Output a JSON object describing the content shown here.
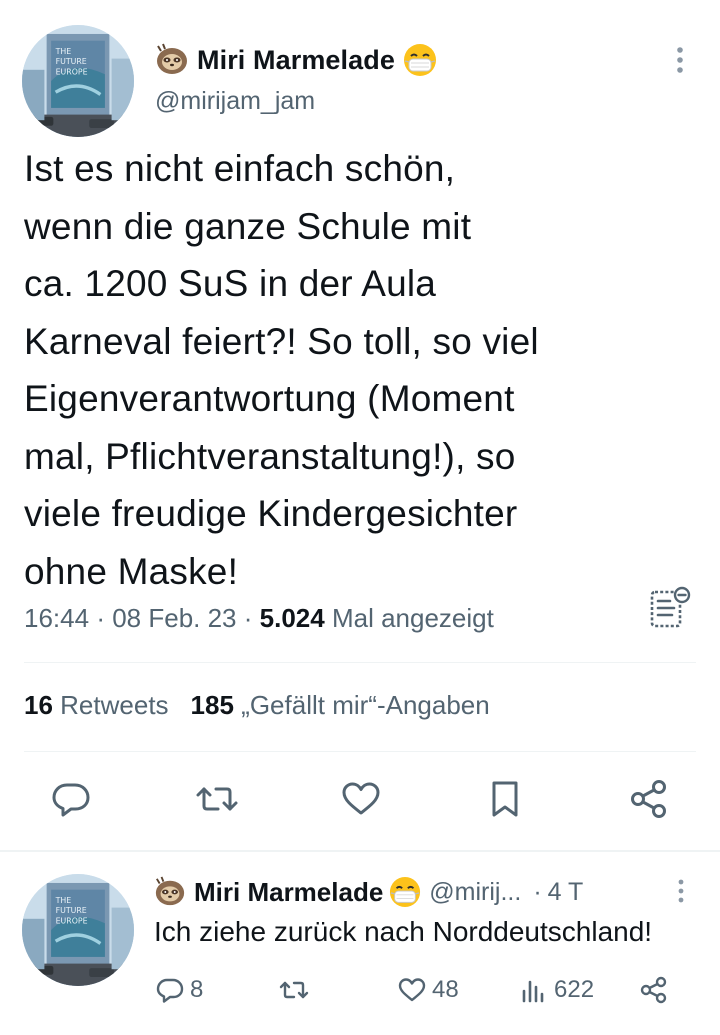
{
  "main_tweet": {
    "display_name": "Miri Marmelade",
    "handle": "@mirijam_jam",
    "text_lines": [
      "Ist es nicht einfach schön,",
      "wenn die ganze Schule mit",
      "ca. 1200 SuS in der Aula",
      "Karneval feiert?! So toll, so viel",
      "Eigenverantwortung (Moment",
      "mal, Pflichtveranstaltung!), so",
      "viele freudige Kindergesichter",
      "ohne Maske!"
    ],
    "time": "16:44",
    "date": "08 Feb. 23",
    "views_count": "5.024",
    "views_label": "Mal angezeigt",
    "retweets_count": "16",
    "retweets_label": "Retweets",
    "likes_count": "185",
    "likes_label": "„Gefällt mir“-Angaben"
  },
  "reply_tweet": {
    "display_name": "Miri Marmelade",
    "handle": "@mirij...",
    "time_ago": "4 T",
    "text": "Ich ziehe zurück nach Norddeutschland!",
    "replies": "8",
    "likes": "48",
    "views": "622"
  },
  "icons": {
    "name_prefix": "sloth-emoji-icon",
    "name_suffix": "mask-face-emoji-icon",
    "avatar": "avatar-image"
  },
  "colors": {
    "text": "#0f1419",
    "secondary": "#536471",
    "divider": "#eff3f4"
  }
}
